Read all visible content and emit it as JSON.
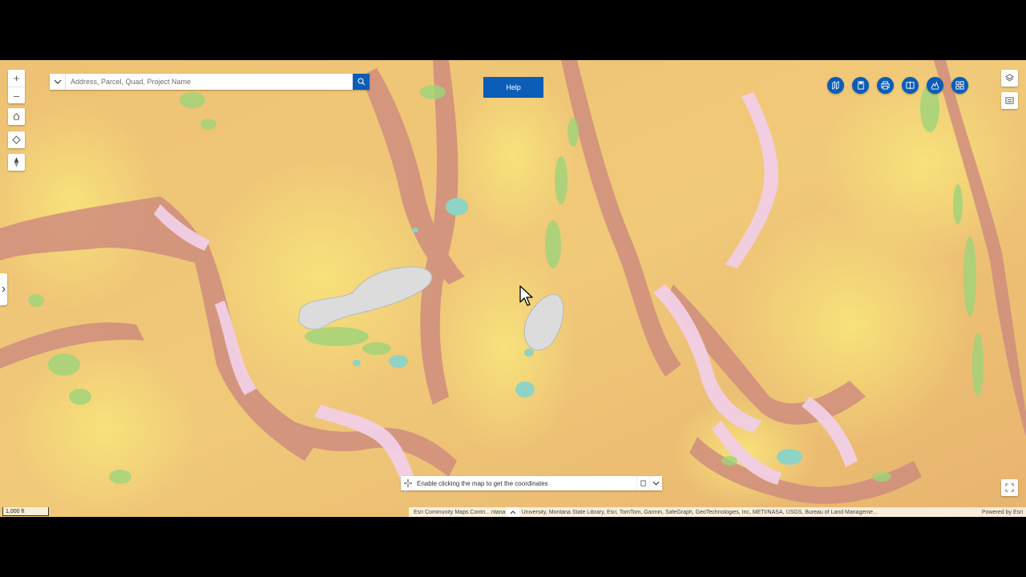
{
  "search": {
    "placeholder": "Address, Parcel, Quad, Project Name"
  },
  "help_label": "Help",
  "nav": {
    "zoom_in": "+",
    "zoom_out": "–"
  },
  "toolbar": {
    "tools": [
      "map-compare-icon",
      "bookmark-icon",
      "print-icon",
      "swipe-icon",
      "elevation-profile-icon",
      "basemap-gallery-icon"
    ]
  },
  "coordinates": {
    "prompt": "Enable clicking the map to get the coordinates"
  },
  "scalebar": {
    "label": "1,000 ft"
  },
  "attribution": {
    "text": "Esri Community Maps Contri... ntana State University, Montana State Library, Esri, TomTom, Garmin, SafeGraph, GeoTechnologies, Inc, METI/NASA, USGS, Bureau of Land Manageme...",
    "powered": "Powered by Esri"
  },
  "colors": {
    "accent": "#0b5db8",
    "terrain_low": "#f3d770",
    "terrain_mid": "#e9a765",
    "terrain_steep": "#c98482",
    "terrain_cliff": "#f2d4ec",
    "vegetation": "#9ed47a",
    "water": "#dcdcdc",
    "pond": "#8ed3c3"
  }
}
